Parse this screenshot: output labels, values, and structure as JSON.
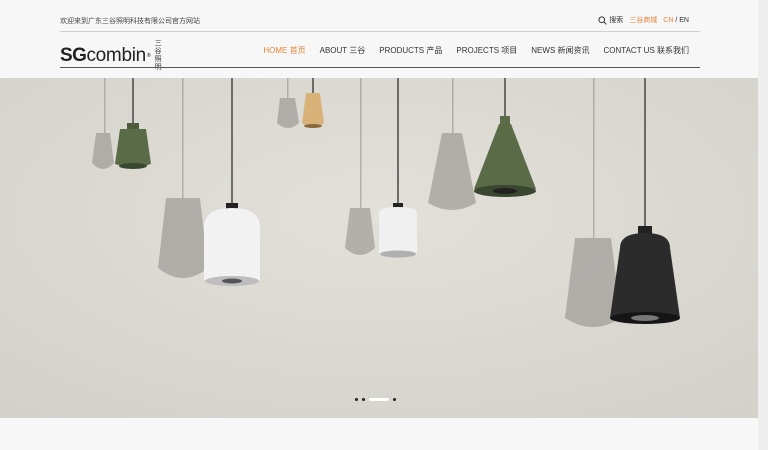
{
  "header": {
    "welcome": "欢迎来到广东三谷照明科技有限公司官方网站",
    "search_label": "搜索",
    "mall_label": "三谷商城",
    "lang_cn": "CN",
    "lang_sep": "/",
    "lang_en": "EN"
  },
  "logo": {
    "sg": "SG",
    "combin": "combin",
    "reg": "®",
    "cn_line1": "三谷",
    "cn_line2": "照明"
  },
  "nav": [
    {
      "label": "HOME 首页",
      "active": true
    },
    {
      "label": "ABOUT 三谷",
      "active": false
    },
    {
      "label": "PRODUCTS 产品",
      "active": false
    },
    {
      "label": "PROJECTS 项目",
      "active": false
    },
    {
      "label": "NEWS 新闻资讯",
      "active": false
    },
    {
      "label": "CONTACT US 联系我们",
      "active": false
    }
  ],
  "slider": {
    "slide_count": 4,
    "active_index": 2
  },
  "colors": {
    "accent": "#e8843a",
    "wall": "#dedbd5",
    "lamp_green": "#5a6b48",
    "lamp_white": "#f2f2f2",
    "lamp_black": "#2b2b2b",
    "lamp_wood": "#d9b27a"
  }
}
